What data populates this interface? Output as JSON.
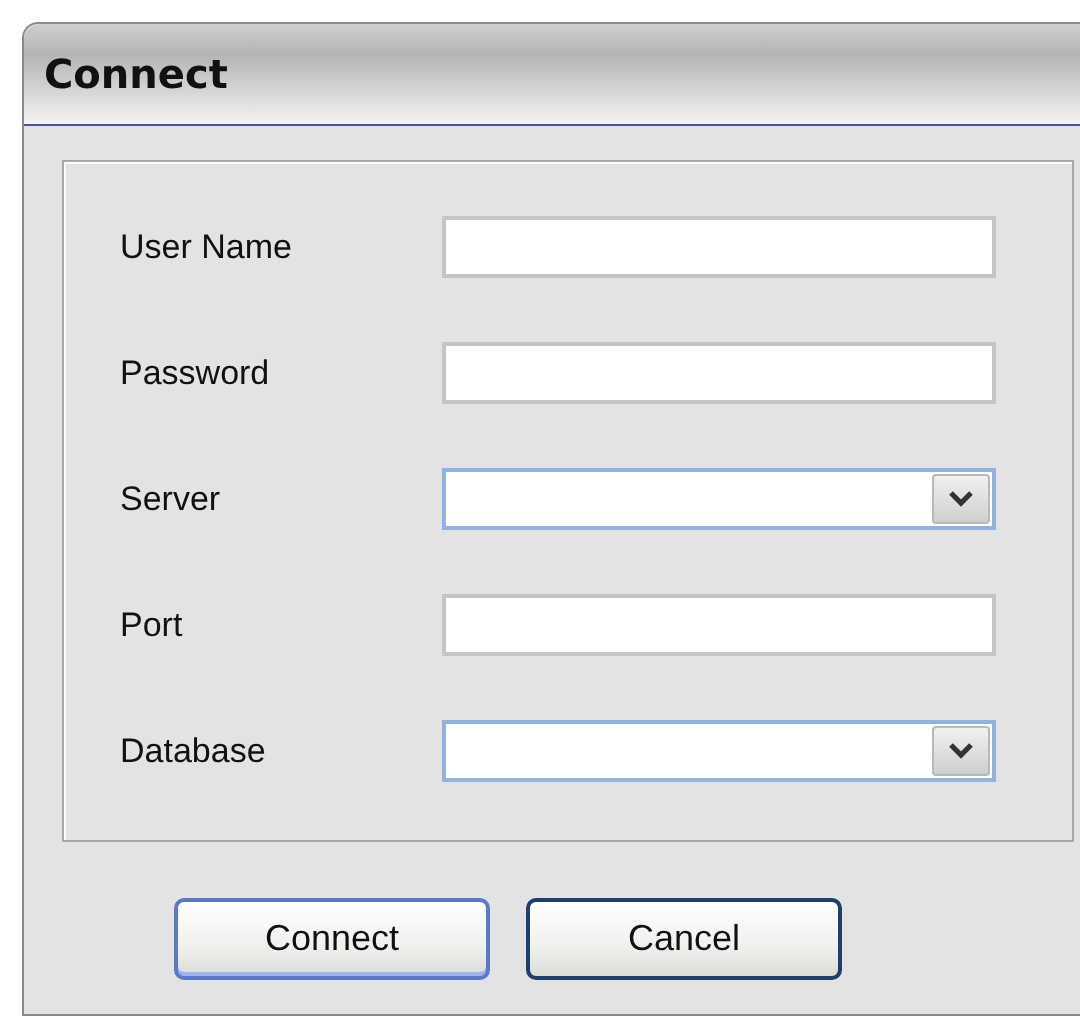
{
  "window": {
    "title": "Connect"
  },
  "fields": [
    {
      "label": "User Name",
      "kind": "text"
    },
    {
      "label": "Password",
      "kind": "text"
    },
    {
      "label": "Server",
      "kind": "dropdown"
    },
    {
      "label": "Port",
      "kind": "text"
    },
    {
      "label": "Database",
      "kind": "dropdown"
    }
  ],
  "buttons": [
    {
      "label": "Connect",
      "default": true
    },
    {
      "label": "Cancel",
      "default": false
    }
  ]
}
